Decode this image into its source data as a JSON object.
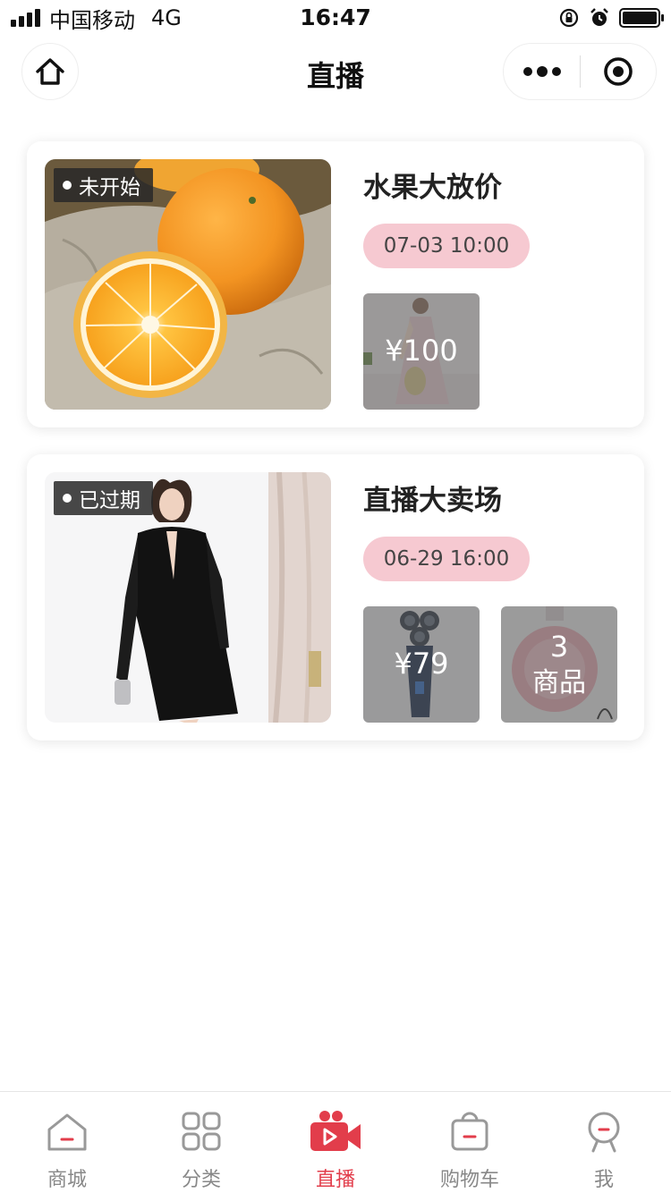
{
  "status_bar": {
    "carrier": "中国移动",
    "network": "4G",
    "time": "16:47",
    "icons": [
      "signal-icon",
      "rotation-lock-icon",
      "alarm-icon",
      "battery-icon"
    ]
  },
  "nav": {
    "title": "直播",
    "home_icon": "home-icon",
    "more_icon": "more-dots-icon",
    "close_icon": "target-icon"
  },
  "live_list": [
    {
      "title": "水果大放价",
      "status": "未开始",
      "time": "07-03 10:00",
      "cover_image": "oranges-photo",
      "products": [
        {
          "label": "¥100",
          "image": "dress-photo"
        }
      ]
    },
    {
      "title": "直播大卖场",
      "status": "已过期",
      "time": "06-29 16:00",
      "cover_image": "black-dress-model-photo",
      "products": [
        {
          "label": "¥79",
          "image": "shaver-photo"
        },
        {
          "count": "3",
          "count_label": "商品",
          "image": "perfume-photo"
        }
      ]
    }
  ],
  "tabbar": {
    "active_color": "#e23d4b",
    "inactive_color": "#888888",
    "items": [
      {
        "label": "商城",
        "icon": "shop-icon",
        "active": false
      },
      {
        "label": "分类",
        "icon": "category-grid-icon",
        "active": false
      },
      {
        "label": "直播",
        "icon": "video-camera-icon",
        "active": true
      },
      {
        "label": "购物车",
        "icon": "shopping-bag-icon",
        "active": false
      },
      {
        "label": "我",
        "icon": "user-icon",
        "active": false
      }
    ]
  }
}
